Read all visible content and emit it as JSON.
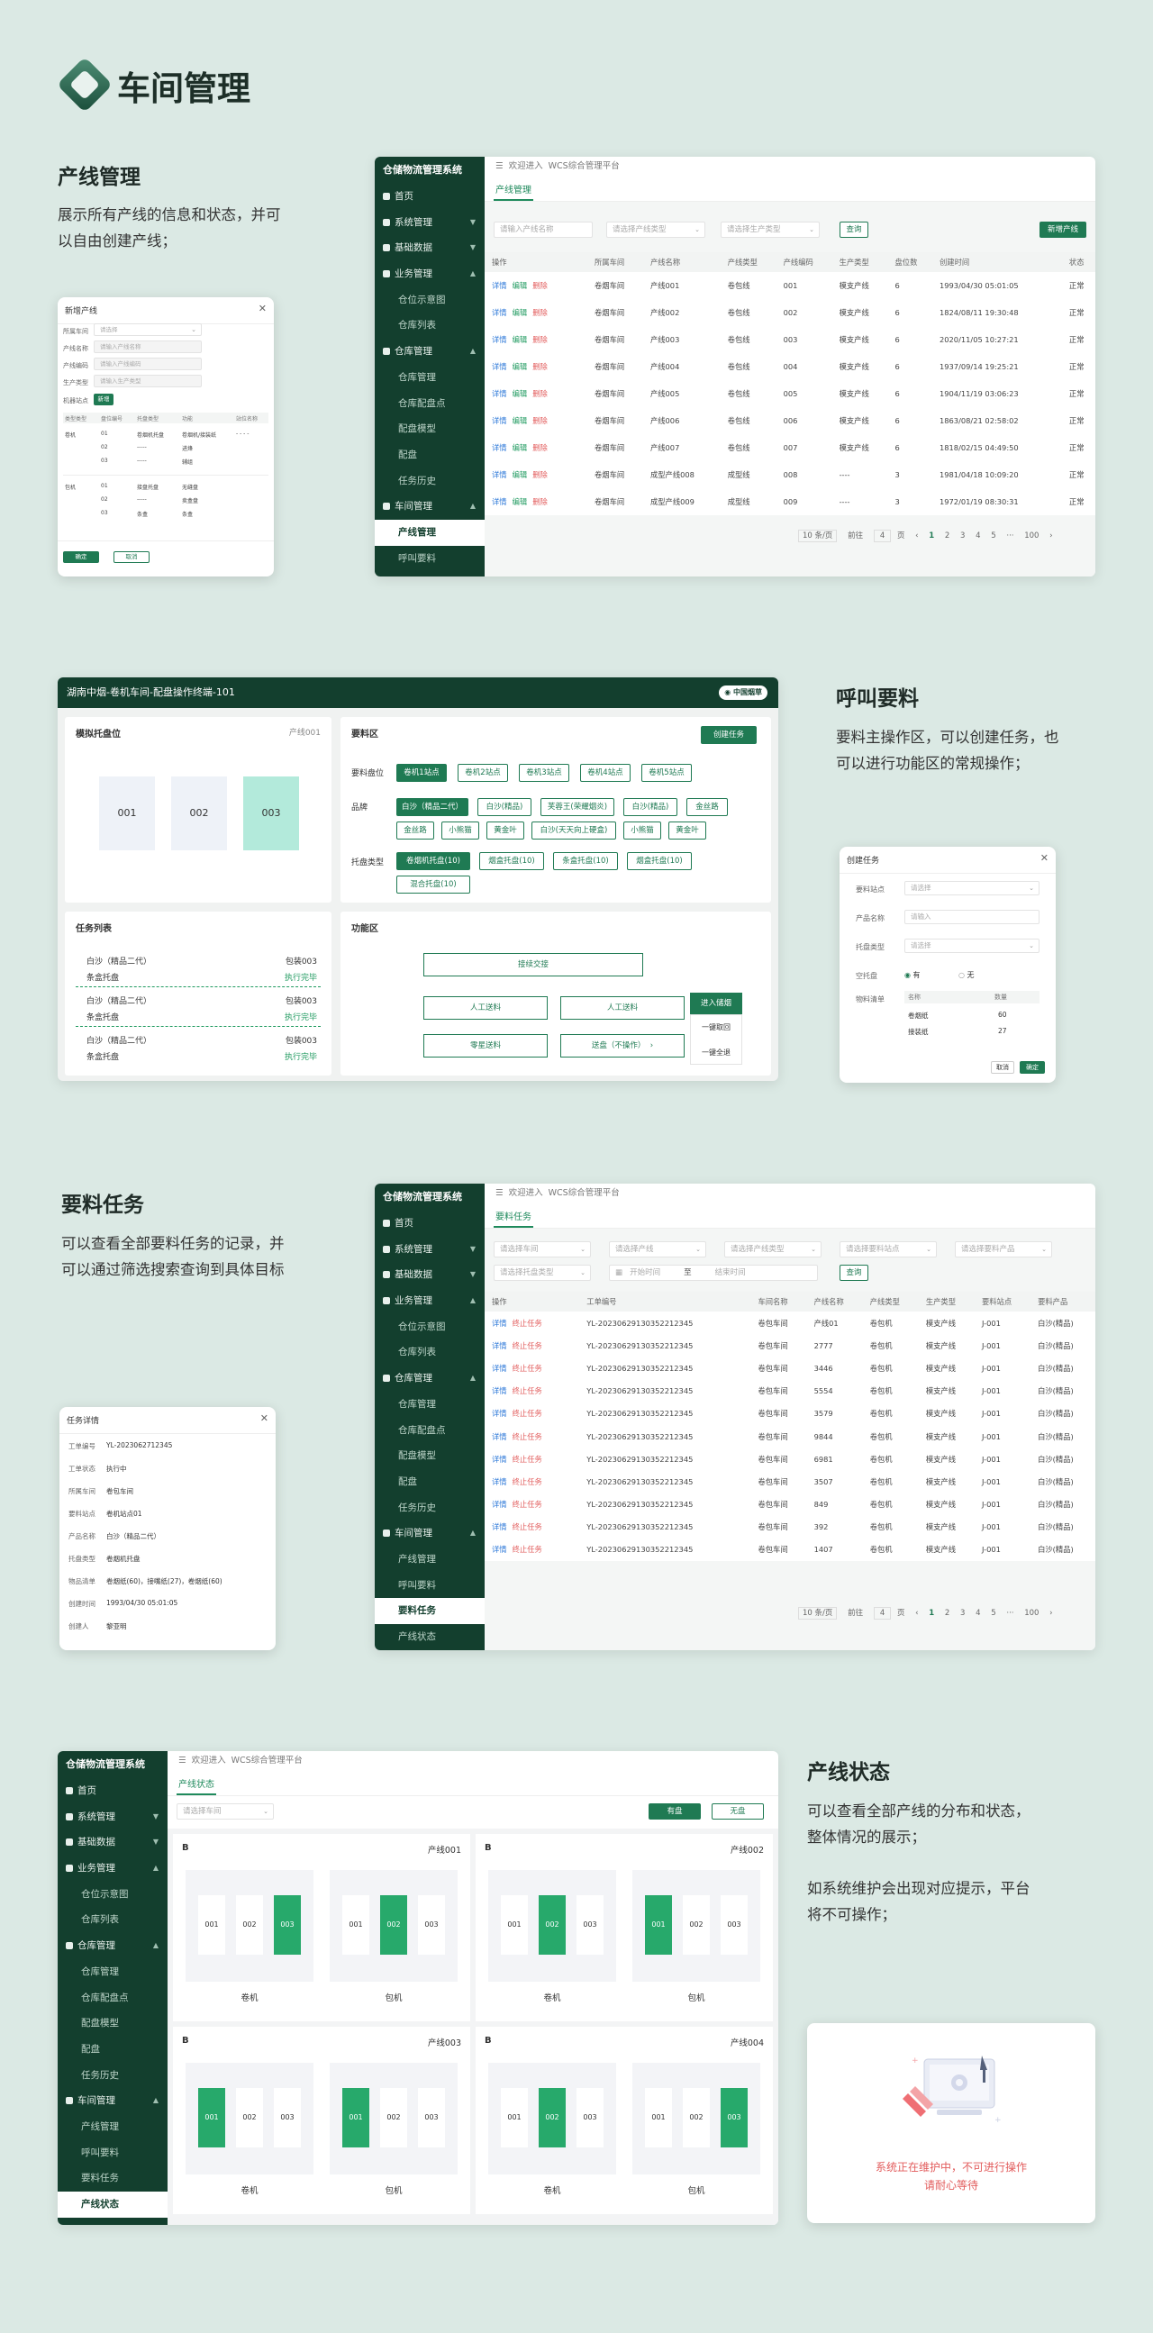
{
  "hero": {
    "title": "车间管理"
  },
  "sections": {
    "s1": {
      "title": "产线管理",
      "desc1": "展示所有产线的信息和状态，并可",
      "desc2": "以自由创建产线；"
    },
    "s2": {
      "title": "呼叫要料",
      "desc1": "要料主操作区，可以创建任务，也",
      "desc2": "可以进行功能区的常规操作；"
    },
    "s3": {
      "title": "要料任务",
      "desc1": "可以查看全部要料任务的记录，并",
      "desc2": "可以通过筛选搜索查询到具体目标"
    },
    "s4": {
      "title": "产线状态",
      "desc1": "可以查看全部产线的分布和状态，",
      "desc2": "整体情况的展示；",
      "desc3": "如系统维护会出现对应提示，平台",
      "desc4": "将不可操作；"
    }
  },
  "sidebar": {
    "title": "仓储物流管理系统",
    "home": "首页",
    "system": "系统管理",
    "basic": "基础数据",
    "business": "业务管理",
    "loc_map": "仓位示意图",
    "loc_list": "仓库列表",
    "warehouse": "仓库管理",
    "wh_mgmt": "仓库管理",
    "wh_point": "仓库配盘点",
    "pan_model": "配盘模型",
    "pan": "配盘",
    "task_hist": "任务历史",
    "workshop": "车间管理",
    "line_mgmt": "产线管理",
    "call": "呼叫要料",
    "material_task": "要料任务",
    "line_status": "产线状态"
  },
  "topbar": {
    "welcome": "欢迎进入",
    "system": "WCS综合管理平台"
  },
  "app1": {
    "tab": "产线管理",
    "input_name": "请输入产线名称",
    "sel_workshop": "请选择产线类型",
    "sel_prod": "请选择生产类型",
    "query": "查询",
    "new": "新增产线",
    "headers": [
      "操作",
      "所属车间",
      "产线名称",
      "产线类型",
      "产线编码",
      "生产类型",
      "盘位数",
      "创建时间",
      "状态"
    ],
    "ops": [
      "详情",
      "编辑",
      "删除"
    ],
    "rows": [
      [
        "卷烟车间",
        "产线001",
        "卷包线",
        "001",
        "模支产线",
        "6",
        "1993/04/30 05:01:05",
        "正常"
      ],
      [
        "卷烟车间",
        "产线002",
        "卷包线",
        "002",
        "模支产线",
        "6",
        "1824/08/11 19:30:48",
        "正常"
      ],
      [
        "卷烟车间",
        "产线003",
        "卷包线",
        "003",
        "模支产线",
        "6",
        "2020/11/05 10:27:21",
        "正常"
      ],
      [
        "卷烟车间",
        "产线004",
        "卷包线",
        "004",
        "模支产线",
        "6",
        "1937/09/14 19:25:21",
        "正常"
      ],
      [
        "卷烟车间",
        "产线005",
        "卷包线",
        "005",
        "模支产线",
        "6",
        "1904/11/19 03:06:23",
        "正常"
      ],
      [
        "卷烟车间",
        "产线006",
        "卷包线",
        "006",
        "模支产线",
        "6",
        "1863/08/21 02:58:02",
        "正常"
      ],
      [
        "卷烟车间",
        "产线007",
        "卷包线",
        "007",
        "模支产线",
        "6",
        "1818/02/15 04:49:50",
        "正常"
      ],
      [
        "卷烟车间",
        "成型产线008",
        "成型线",
        "008",
        "----",
        "3",
        "1981/04/18 10:09:20",
        "正常"
      ],
      [
        "卷烟车间",
        "成型产线009",
        "成型线",
        "009",
        "----",
        "3",
        "1972/01/19 08:30:31",
        "正常"
      ]
    ],
    "pager": {
      "size": "10 条/页",
      "goto": "前往",
      "page_val": "4",
      "page_unit": "页",
      "pages": [
        "1",
        "2",
        "3",
        "4",
        "5",
        "···",
        "100"
      ]
    }
  },
  "modal1": {
    "title": "新增产线",
    "l_workshop": "所属车间",
    "v_workshop": "请选择",
    "l_name": "产线名称",
    "v_name": "请输入产线名称",
    "l_code": "产线编码",
    "v_code": "请输入产线编码",
    "l_type": "生产类型",
    "v_type": "请输入生产类型",
    "l_pos": "机器站点",
    "v_pos": "新增",
    "heads": [
      "类型类型",
      "盘位编号",
      "托盘类型",
      "功能",
      "站位名称"
    ],
    "g1": "卷机",
    "g1r": [
      [
        "01",
        "卷烟机托盘",
        "卷烟机/接装纸",
        "- - - -"
      ],
      [
        "02",
        "-----",
        "进烽",
        ""
      ],
      [
        "03",
        "-----",
        "辅组",
        ""
      ]
    ],
    "g2": "包机",
    "g2r": [
      [
        "01",
        "接盘托盘",
        "无缝盘",
        ""
      ],
      [
        "02",
        "-----",
        "卖盒盘",
        ""
      ],
      [
        "03",
        "条盒",
        "条盒",
        ""
      ]
    ],
    "confirm": "确定",
    "cancel": "取消"
  },
  "terminal": {
    "title": "湖南中烟-卷机车间-配盘操作终端-101",
    "brand": "中国烟草",
    "pallet_title": "模拟托盘位",
    "pallet_line": "产线001",
    "slots": [
      "001",
      "002",
      "003"
    ],
    "material_title": "要料区",
    "create": "创建任务",
    "l_site": "要料盘位",
    "sites": [
      "卷机1站点",
      "卷机2站点",
      "卷机3站点",
      "卷机4站点",
      "卷机5站点"
    ],
    "l_brand": "品牌",
    "brands1": [
      "白沙（精品二代）",
      "白沙(精品)",
      "芙蓉王(荣耀烟炎)",
      "白沙(精品)",
      "金丝路"
    ],
    "brands2": [
      "金丝路",
      "小熊猫",
      "黄金叶",
      "白沙(天天向上硬盒)",
      "小熊猫",
      "黄金叶"
    ],
    "l_tray": "托盘类型",
    "trays1": [
      "卷烟机托盘(10)",
      "烟盒托盘(10)",
      "条盒托盘(10)",
      "烟盒托盘(10)"
    ],
    "trays2": [
      "混合托盘(10)"
    ],
    "task_title": "任务列表",
    "tasks": [
      {
        "a": "白沙（精品二代）",
        "b": "包装003",
        "c": "条盒托盘",
        "d": "执行完毕"
      },
      {
        "a": "白沙（精品二代）",
        "b": "包装003",
        "c": "条盒托盘",
        "d": "执行完毕"
      },
      {
        "a": "白沙（精品二代）",
        "b": "包装003",
        "c": "条盒托盘",
        "d": "执行完毕"
      }
    ],
    "func_title": "功能区",
    "f_box": "接续交接",
    "f_manual1": "人工送料",
    "f_manual2": "人工送料",
    "f_enter": "进入储烟",
    "f_clean": "一键取回",
    "f_all": "一键全退",
    "f_empty": "零星送料",
    "f_send": "送盘（不操作）"
  },
  "modal2": {
    "title": "创建任务",
    "l_site": "要料站点",
    "v_site": "请选择",
    "l_prod": "产品名称",
    "v_prod": "请输入",
    "l_tray": "托盘类型",
    "v_tray": "请选择",
    "l_empty": "空托盘",
    "opt_yes": "有",
    "opt_no": "无",
    "l_list": "物料清单",
    "h_name": "名称",
    "h_qty": "数量",
    "items": [
      [
        "卷烟纸",
        "60"
      ],
      [
        "接装纸",
        "27"
      ]
    ],
    "cancel": "取消",
    "confirm": "确定"
  },
  "app2": {
    "tab": "要料任务",
    "filters": [
      "请选择车间",
      "请选择产线",
      "请选择产线类型",
      "请选择要料站点",
      "请选择要料产品"
    ],
    "f_tray": "请选择托盘类型",
    "f_start": "开始时间",
    "f_to": "至",
    "f_end": "结束时间",
    "query": "查询",
    "headers": [
      "操作",
      "工单编号",
      "车间名称",
      "产线名称",
      "产线类型",
      "生产类型",
      "要料站点",
      "要料产品"
    ],
    "ops": [
      "详情",
      "终止任务"
    ],
    "rows": [
      [
        "YL-2023062913035221234​5",
        "卷包车间",
        "产线01",
        "卷包机",
        "模支产线",
        "J-001",
        "白沙(精品)"
      ],
      [
        "YL-20230629130352212345",
        "卷包车间",
        "2777",
        "卷包机",
        "模支产线",
        "J-001",
        "白沙(精品)"
      ],
      [
        "YL-20230629130352212345",
        "卷包车间",
        "3446",
        "卷包机",
        "模支产线",
        "J-001",
        "白沙(精品)"
      ],
      [
        "YL-20230629130352212345",
        "卷包车间",
        "5554",
        "卷包机",
        "模支产线",
        "J-001",
        "白沙(精品)"
      ],
      [
        "YL-20230629130352212345",
        "卷包车间",
        "3579",
        "卷包机",
        "模支产线",
        "J-001",
        "白沙(精品)"
      ],
      [
        "YL-20230629130352212345",
        "卷包车间",
        "9844",
        "卷包机",
        "模支产线",
        "J-001",
        "白沙(精品)"
      ],
      [
        "YL-20230629130352212345",
        "卷包车间",
        "6981",
        "卷包机",
        "模支产线",
        "J-001",
        "白沙(精品)"
      ],
      [
        "YL-20230629130352212345",
        "卷包车间",
        "3507",
        "卷包机",
        "模支产线",
        "J-001",
        "白沙(精品)"
      ],
      [
        "YL-20230629130352212345",
        "卷包车间",
        "849",
        "卷包机",
        "模支产线",
        "J-001",
        "白沙(精品)"
      ],
      [
        "YL-20230629130352212345",
        "卷包车间",
        "392",
        "卷包机",
        "模支产线",
        "J-001",
        "白沙(精品)"
      ],
      [
        "YL-20230629130352212345",
        "卷包车间",
        "1407",
        "卷包机",
        "模支产线",
        "J-001",
        "白沙(精品)"
      ]
    ]
  },
  "modal3": {
    "title": "任务详情",
    "rows": [
      [
        "工单编号",
        "YL-2023062712345"
      ],
      [
        "工单状态",
        "执行中"
      ],
      [
        "所属车间",
        "卷包车间"
      ],
      [
        "要料站点",
        "卷机站点01"
      ],
      [
        "产品名称",
        "白沙（精品二代）"
      ],
      [
        "托盘类型",
        "卷烟机托盘"
      ],
      [
        "物品清单",
        "卷烟纸(60)，接嘴纸(27)，卷烟纸(60)"
      ],
      [
        "创建时间",
        "1993/04/30  05:01:05"
      ],
      [
        "创建人",
        "黎亚明"
      ]
    ]
  },
  "app3": {
    "tab": "产线状态",
    "sel": "请选择车间",
    "btn1": "有盘",
    "btn2": "无盘",
    "cards": [
      {
        "name": "B",
        "line": "产线001",
        "g1": [
          false,
          false,
          true
        ],
        "g2": [
          false,
          true,
          false
        ]
      },
      {
        "name": "B",
        "line": "产线002",
        "g1": [
          false,
          true,
          false
        ],
        "g2": [
          true,
          false,
          false
        ]
      },
      {
        "name": "B",
        "line": "产线003",
        "g1": [
          true,
          false,
          false
        ],
        "g2": [
          true,
          false,
          false
        ]
      },
      {
        "name": "B",
        "line": "产线004",
        "g1": [
          false,
          true,
          false
        ],
        "g2": [
          false,
          false,
          true
        ]
      }
    ],
    "slot_labels": [
      "001",
      "002",
      "003"
    ],
    "g1_label": "卷机",
    "g2_label": "包机"
  },
  "maintenance": {
    "line1": "系统正在维护中，不可进行操作",
    "line2": "请耐心等待"
  }
}
